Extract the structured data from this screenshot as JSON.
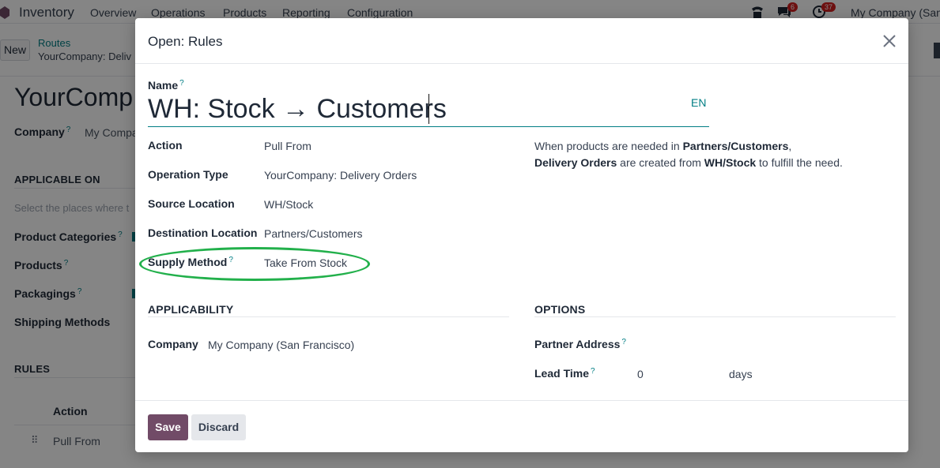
{
  "app": {
    "name": "Inventory",
    "menu": [
      "Overview",
      "Operations",
      "Products",
      "Reporting",
      "Configuration"
    ],
    "chat_badge": "6",
    "activity_badge": "37",
    "company": "My Company (San"
  },
  "breadcrumb": {
    "new_label": "New",
    "parent": "Routes",
    "current": "YourCompany: Deliv"
  },
  "background_form": {
    "title": "YourComp",
    "company_label": "Company",
    "company_value": "My Compa",
    "applicable_on_heading": "APPLICABLE ON",
    "applicable_hint": "Select the places where t",
    "product_categories_label": "Product Categories",
    "products_label": "Products",
    "packagings_label": "Packagings",
    "shipping_methods_label": "Shipping Methods",
    "rules_heading": "RULES",
    "rules_col_action": "Action",
    "rules_row1_action": "Pull From"
  },
  "modal": {
    "title": "Open: Rules",
    "name_label": "Name",
    "name_value": "WH: Stock → Customers",
    "lang": "EN",
    "fields": {
      "action_label": "Action",
      "action_value": "Pull From",
      "operation_type_label": "Operation Type",
      "operation_type_value": "YourCompany: Delivery Orders",
      "source_location_label": "Source Location",
      "source_location_value": "WH/Stock",
      "destination_location_label": "Destination Location",
      "destination_location_value": "Partners/Customers",
      "supply_method_label": "Supply Method",
      "supply_method_value": "Take From Stock"
    },
    "description": {
      "part1": "When products are needed in ",
      "bold1": "Partners/Customers",
      "part2": ",",
      "bold2": "Delivery Orders",
      "part3": " are created from ",
      "bold3": "WH/Stock",
      "part4": " to fulfill the need."
    },
    "applicability": {
      "heading": "APPLICABILITY",
      "company_label": "Company",
      "company_value": "My Company (San Francisco)"
    },
    "options": {
      "heading": "OPTIONS",
      "partner_address_label": "Partner Address",
      "lead_time_label": "Lead Time",
      "lead_time_value": "0",
      "lead_time_unit": "days"
    },
    "save_label": "Save",
    "discard_label": "Discard"
  }
}
